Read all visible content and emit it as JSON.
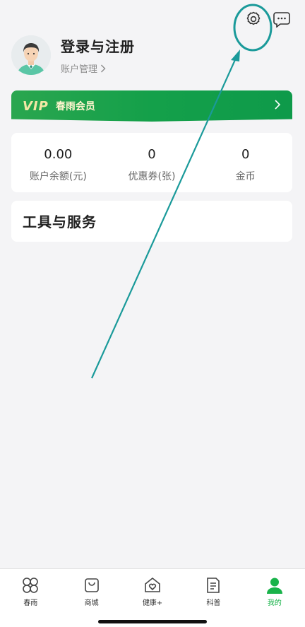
{
  "header": {
    "settings_icon": "gear-icon",
    "messages_icon": "chat-bubble-icon"
  },
  "profile": {
    "login_label": "登录与注册",
    "account_link": "账户管理"
  },
  "vip": {
    "logo": "VIP",
    "label": "春雨会员"
  },
  "wallet": {
    "items": [
      {
        "value": "0.00",
        "label": "账户余额(元)"
      },
      {
        "value": "0",
        "label": "优惠券(张)"
      },
      {
        "value": "0",
        "label": "金币"
      }
    ]
  },
  "tools": {
    "title": "工具与服务"
  },
  "tabbar": {
    "tabs": [
      {
        "label": "春雨",
        "icon": "clover-icon"
      },
      {
        "label": "商城",
        "icon": "shopping-bag-icon"
      },
      {
        "label": "健康+",
        "icon": "home-heart-icon"
      },
      {
        "label": "科普",
        "icon": "document-icon"
      },
      {
        "label": "我的",
        "icon": "person-icon",
        "active": true
      }
    ]
  },
  "colors": {
    "accent": "#19b34a",
    "vip_green": "#14a04a",
    "annotation": "#1a9a9a",
    "background": "#f4f4f6"
  }
}
